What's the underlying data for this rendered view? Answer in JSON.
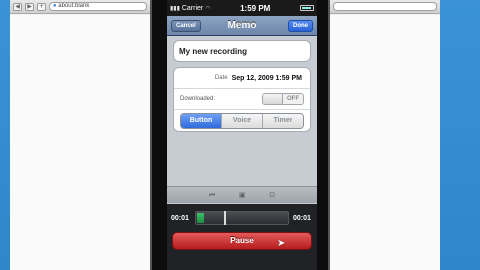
{
  "browser": {
    "address": "about:blank",
    "back_icon": "back-arrow-icon",
    "forward_icon": "forward-arrow-icon",
    "add_icon": "plus-icon",
    "globe_icon": "globe-icon"
  },
  "status_bar": {
    "carrier": "Carrier",
    "time": "1:59 PM"
  },
  "nav_bar": {
    "cancel_label": "Cancel",
    "title": "Memo",
    "done_label": "Done"
  },
  "memo": {
    "title_value": "My new recording",
    "date_label": "Date",
    "date_value": "Sep 12, 2009 1:59 PM",
    "downloaded_label": "Downloaded:",
    "downloaded_state": "OFF"
  },
  "segments": {
    "items": [
      "Button",
      "Voice",
      "Timer"
    ],
    "selected": "Button"
  },
  "player": {
    "icons": [
      "prev-icon",
      "play-icon",
      "next-icon"
    ]
  },
  "recorder": {
    "elapsed": "00:01",
    "total": "00:01",
    "progress_fraction": 0.08,
    "pause_label": "Pause"
  },
  "colors": {
    "desktop_bg": "#3b93d6",
    "pause_red": "#c62828",
    "segment_blue": "#2f6bdc",
    "progress_green": "#2aa655"
  }
}
